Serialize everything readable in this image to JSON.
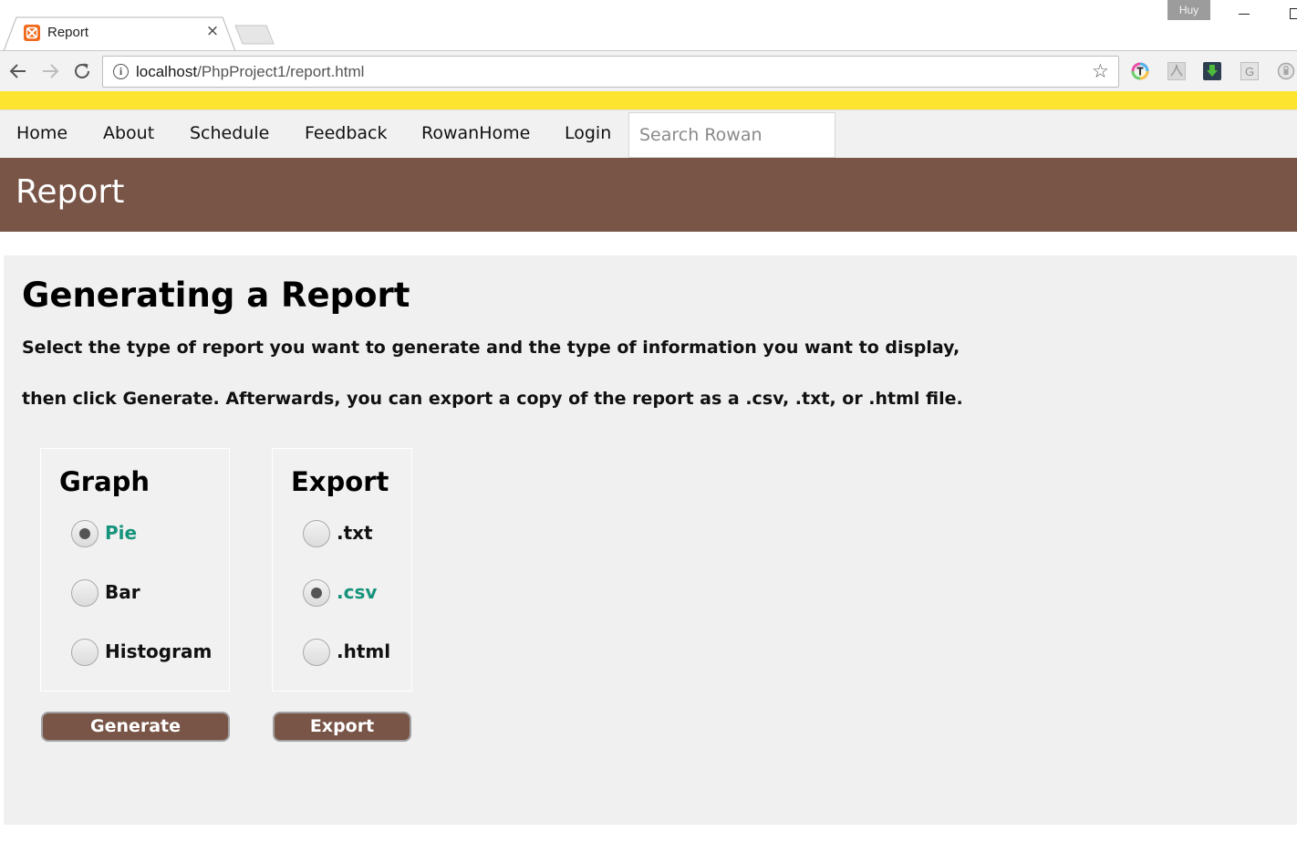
{
  "browser": {
    "tab_title": "Report",
    "tab_close": "×",
    "profile_name": "Huy",
    "url_host": "localhost",
    "url_path": "/PhpProject1/report.html",
    "info_glyph": "i",
    "star_glyph": "☆",
    "extensions": [
      "color-t-extension-icon",
      "pdf-extension-icon",
      "download-extension-icon",
      "g-extension-icon",
      "lock-extension-icon"
    ],
    "ext_g_letter": "G",
    "accent_yellow": "#fde52f"
  },
  "nav": {
    "items": [
      "Home",
      "About",
      "Schedule",
      "Feedback",
      "RowanHome",
      "Login"
    ],
    "search_placeholder": "Search Rowan"
  },
  "header": {
    "title": "Report",
    "color": "#795548"
  },
  "main": {
    "heading": "Generating a Report",
    "instructions": [
      "Select the type of report you want to generate and the type of information you want to display,",
      "then click Generate. Afterwards, you can export a copy of the report as a .csv, .txt, or .html file."
    ],
    "graph": {
      "title": "Graph",
      "options": [
        "Pie",
        "Bar",
        "Histogram"
      ],
      "selected": "Pie",
      "button": "Generate"
    },
    "export": {
      "title": "Export",
      "options": [
        ".txt",
        ".csv",
        ".html"
      ],
      "selected": ".csv",
      "button": "Export"
    },
    "selected_color": "#16947b"
  }
}
